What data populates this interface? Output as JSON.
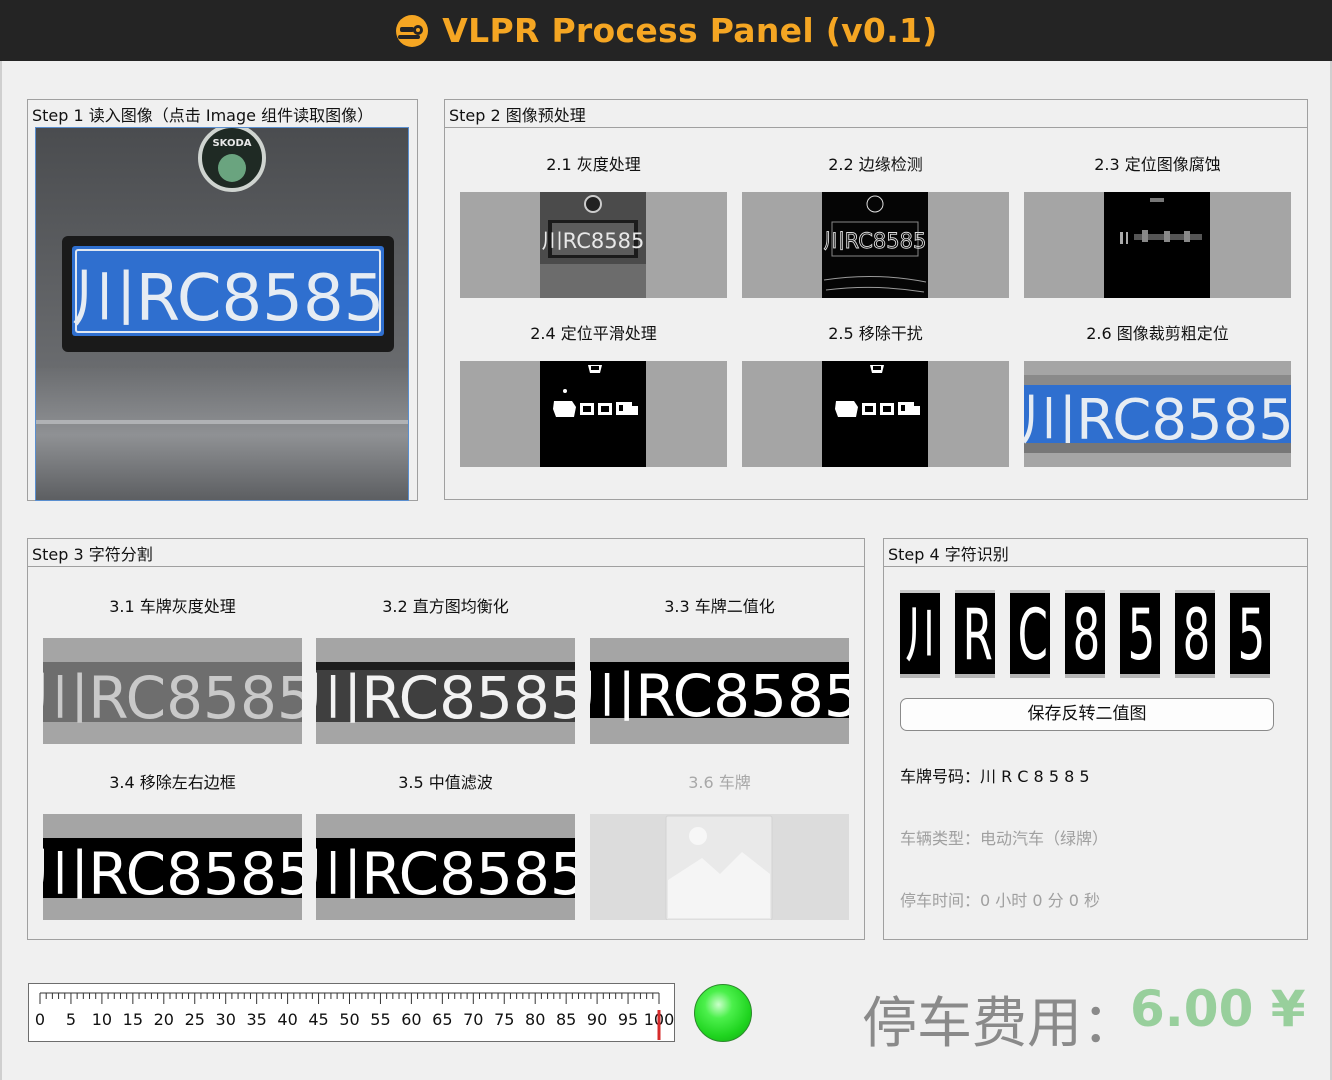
{
  "app": {
    "title": "VLPR Process Panel (v0.1)",
    "icon": "car-logo-icon",
    "title_color": "#f5a623"
  },
  "step1": {
    "title": "Step 1 读入图像（点击 Image 组件读取图像）",
    "plate_text": "川RC8585",
    "badge_text": "SKODA"
  },
  "step2": {
    "title": "Step 2 图像预处理",
    "items": [
      {
        "label": "2.1 灰度处理",
        "plate": "川RC8585"
      },
      {
        "label": "2.2 边缘检测",
        "plate": "川RC8585"
      },
      {
        "label": "2.3 定位图像腐蚀"
      },
      {
        "label": "2.4 定位平滑处理"
      },
      {
        "label": "2.5 移除干扰"
      },
      {
        "label": "2.6 图像裁剪粗定位",
        "plate": "川RC8585"
      }
    ]
  },
  "step3": {
    "title": "Step 3 字符分割",
    "items": [
      {
        "label": "3.1 车牌灰度处理",
        "plate": "川RC8585"
      },
      {
        "label": "3.2 直方图均衡化",
        "plate": "川RC8585"
      },
      {
        "label": "3.3 车牌二值化",
        "plate": "川RC8585"
      },
      {
        "label": "3.4 移除左右边框",
        "plate": "川RC8585"
      },
      {
        "label": "3.5 中值滤波",
        "plate": "川RC8585"
      },
      {
        "label": "3.6 车牌",
        "disabled": true,
        "icon": "image-placeholder-icon"
      }
    ]
  },
  "step4": {
    "title": "Step 4 字符识别",
    "chars": [
      "川",
      "R",
      "C",
      "8",
      "5",
      "8",
      "5"
    ],
    "save_button": "保存反转二值图",
    "plate_number": "车牌号码：川 R C 8 5 8 5",
    "vehicle_type": "车辆类型：电动汽车（绿牌）",
    "parking_time": "停车时间：0 小时 0 分 0 秒"
  },
  "gauge": {
    "ticks": [
      "0",
      "5",
      "10",
      "15",
      "20",
      "25",
      "30",
      "35",
      "40",
      "45",
      "50",
      "55",
      "60",
      "65",
      "70",
      "75",
      "80",
      "85",
      "90",
      "95",
      "100"
    ],
    "value": 100,
    "indicator_color": "#d62b2b"
  },
  "status_led": {
    "color": "#22dd22",
    "state": "on"
  },
  "fee": {
    "label": "停车费用：",
    "value": "6.00 ¥",
    "value_color": "#98cf9c"
  }
}
